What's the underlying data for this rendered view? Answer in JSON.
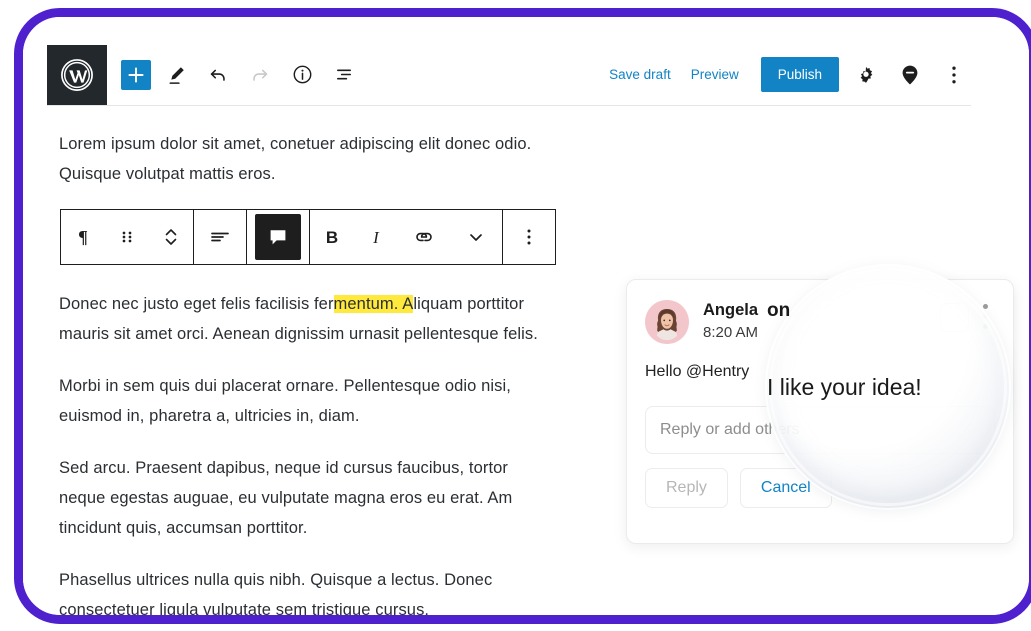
{
  "theme": {
    "frame_border_color": "#4f21ce",
    "accent_blue": "#1283c4",
    "highlight_yellow": "#ffe93d",
    "toolbar_dark": "#23282d"
  },
  "editor_bar": {
    "logo_name": "wordpress-logo",
    "left_tools": [
      {
        "name": "add-block-button",
        "glyph": "+",
        "state": "primary"
      },
      {
        "name": "edit-pencil-icon",
        "glyph": "",
        "state": "normal"
      },
      {
        "name": "undo-icon",
        "glyph": "",
        "state": "normal"
      },
      {
        "name": "redo-icon",
        "glyph": "",
        "state": "disabled"
      },
      {
        "name": "info-icon",
        "glyph": "",
        "state": "normal"
      },
      {
        "name": "list-view-icon",
        "glyph": "",
        "state": "normal"
      }
    ],
    "save_draft_label": "Save draft",
    "preview_label": "Preview",
    "publish_label": "Publish",
    "settings_icon": "gear-icon",
    "pin_icon": "location-pin-icon",
    "more_icon": "more-vertical-icon"
  },
  "document": {
    "paragraphs": [
      {
        "id": "p1",
        "text": "Lorem ipsum dolor sit amet, conetuer adipiscing elit donec odio. Quisque volutpat mattis eros."
      },
      {
        "id": "p2",
        "before": "Donec nec justo eget felis facilisis fer",
        "highlight": "mentum. A",
        "after": "liquam porttitor mauris sit amet orci. Aenean dignissim urnasit pellentesque felis."
      },
      {
        "id": "p3",
        "text": "Morbi in sem quis dui placerat ornare. Pellentesque odio nisi, euismod in, pharetra a, ultricies in, diam."
      },
      {
        "id": "p4",
        "text": "Sed arcu. Praesent dapibus, neque id cursus faucibus, tortor neque egestas auguae, eu vulputate magna eros eu erat. Am tincidunt quis, accumsan porttitor."
      },
      {
        "id": "p5",
        "text": "Phasellus ultrices nulla quis nibh. Quisque a lectus. Donec consectetuer ligula vulputate sem tristique cursus."
      }
    ]
  },
  "block_toolbar": {
    "groups": [
      {
        "items": [
          {
            "name": "paragraph-block-type-icon",
            "label": "¶"
          },
          {
            "name": "drag-handle-icon",
            "label": ""
          },
          {
            "name": "move-up-down-icon",
            "label": ""
          }
        ]
      },
      {
        "items": [
          {
            "name": "align-text-icon",
            "label": ""
          }
        ]
      },
      {
        "items": [
          {
            "name": "add-comment-icon",
            "label": "",
            "state": "active"
          }
        ]
      },
      {
        "items": [
          {
            "name": "bold-icon",
            "label": "B"
          },
          {
            "name": "italic-icon",
            "label": "I"
          },
          {
            "name": "link-icon",
            "label": ""
          },
          {
            "name": "chevron-down-icon",
            "label": ""
          }
        ]
      },
      {
        "items": [
          {
            "name": "more-options-icon",
            "label": ""
          }
        ]
      }
    ]
  },
  "comment_card": {
    "author": "Angela",
    "author_visible_fragment": "Angela",
    "author_magnified_fragment": "on",
    "timestamp": "8:20 AM",
    "body_before_lens": "Hello @Hentry",
    "body_magnified": "I like your idea!",
    "full_body": "Hello @Hentry I like your idea!",
    "reply_placeholder": "Reply or add others",
    "reply_button_label": "Reply",
    "cancel_button_label": "Cancel",
    "checkbox_name": "resolve-checkbox",
    "menu_name": "comment-more-icon"
  },
  "magnifier": {
    "name": "magnifier-lens",
    "magnified_text": "I like your idea!",
    "magnified_name": "on"
  }
}
